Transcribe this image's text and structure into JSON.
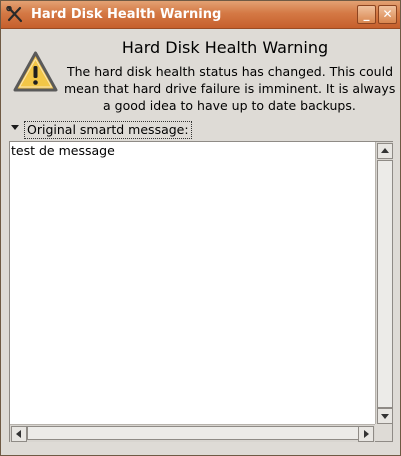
{
  "window": {
    "title": "Hard Disk Health Warning",
    "minimize_glyph": "_",
    "close_glyph": "✕"
  },
  "dialog": {
    "heading": "Hard Disk Health Warning",
    "body_lines": [
      "The hard disk health status has changed. This could",
      "mean that hard drive failure is imminent. It is always",
      "a good idea to have up to date backups."
    ]
  },
  "expander": {
    "label": "Original smartd message:"
  },
  "message": {
    "text": "test de message"
  },
  "colors": {
    "titlebar": "#d47945",
    "warning_fill": "#f1c24a",
    "window_bg": "#dedbd6"
  },
  "icons": {
    "app": "tools-icon",
    "warning": "warning-icon"
  }
}
